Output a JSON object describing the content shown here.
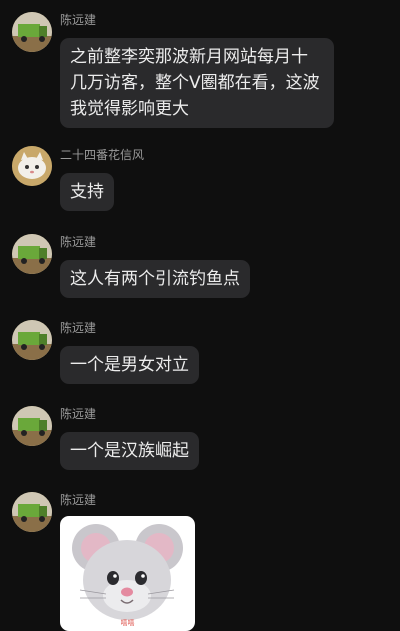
{
  "messages": [
    {
      "sender": "陈远建",
      "avatar": "truck-avatar",
      "text": "之前整李奕那波新月网站每月十几万访客，整个V圈都在看，这波我觉得影响更大"
    },
    {
      "sender": "二十四番花信风",
      "avatar": "cat-avatar",
      "text": "支持"
    },
    {
      "sender": "陈远建",
      "avatar": "truck-avatar",
      "text": "这人有两个引流钓鱼点"
    },
    {
      "sender": "陈远建",
      "avatar": "truck-avatar",
      "text": "一个是男女对立"
    },
    {
      "sender": "陈远建",
      "avatar": "truck-avatar",
      "text": "一个是汉族崛起"
    },
    {
      "sender": "陈远建",
      "avatar": "truck-avatar",
      "sticker": {
        "icon": "mouse-memoji-icon",
        "caption": "嘻嘻"
      }
    }
  ],
  "colors": {
    "background": "#0f0f0f",
    "bubble": "#2a2a2c",
    "name": "#9a9a9a"
  }
}
